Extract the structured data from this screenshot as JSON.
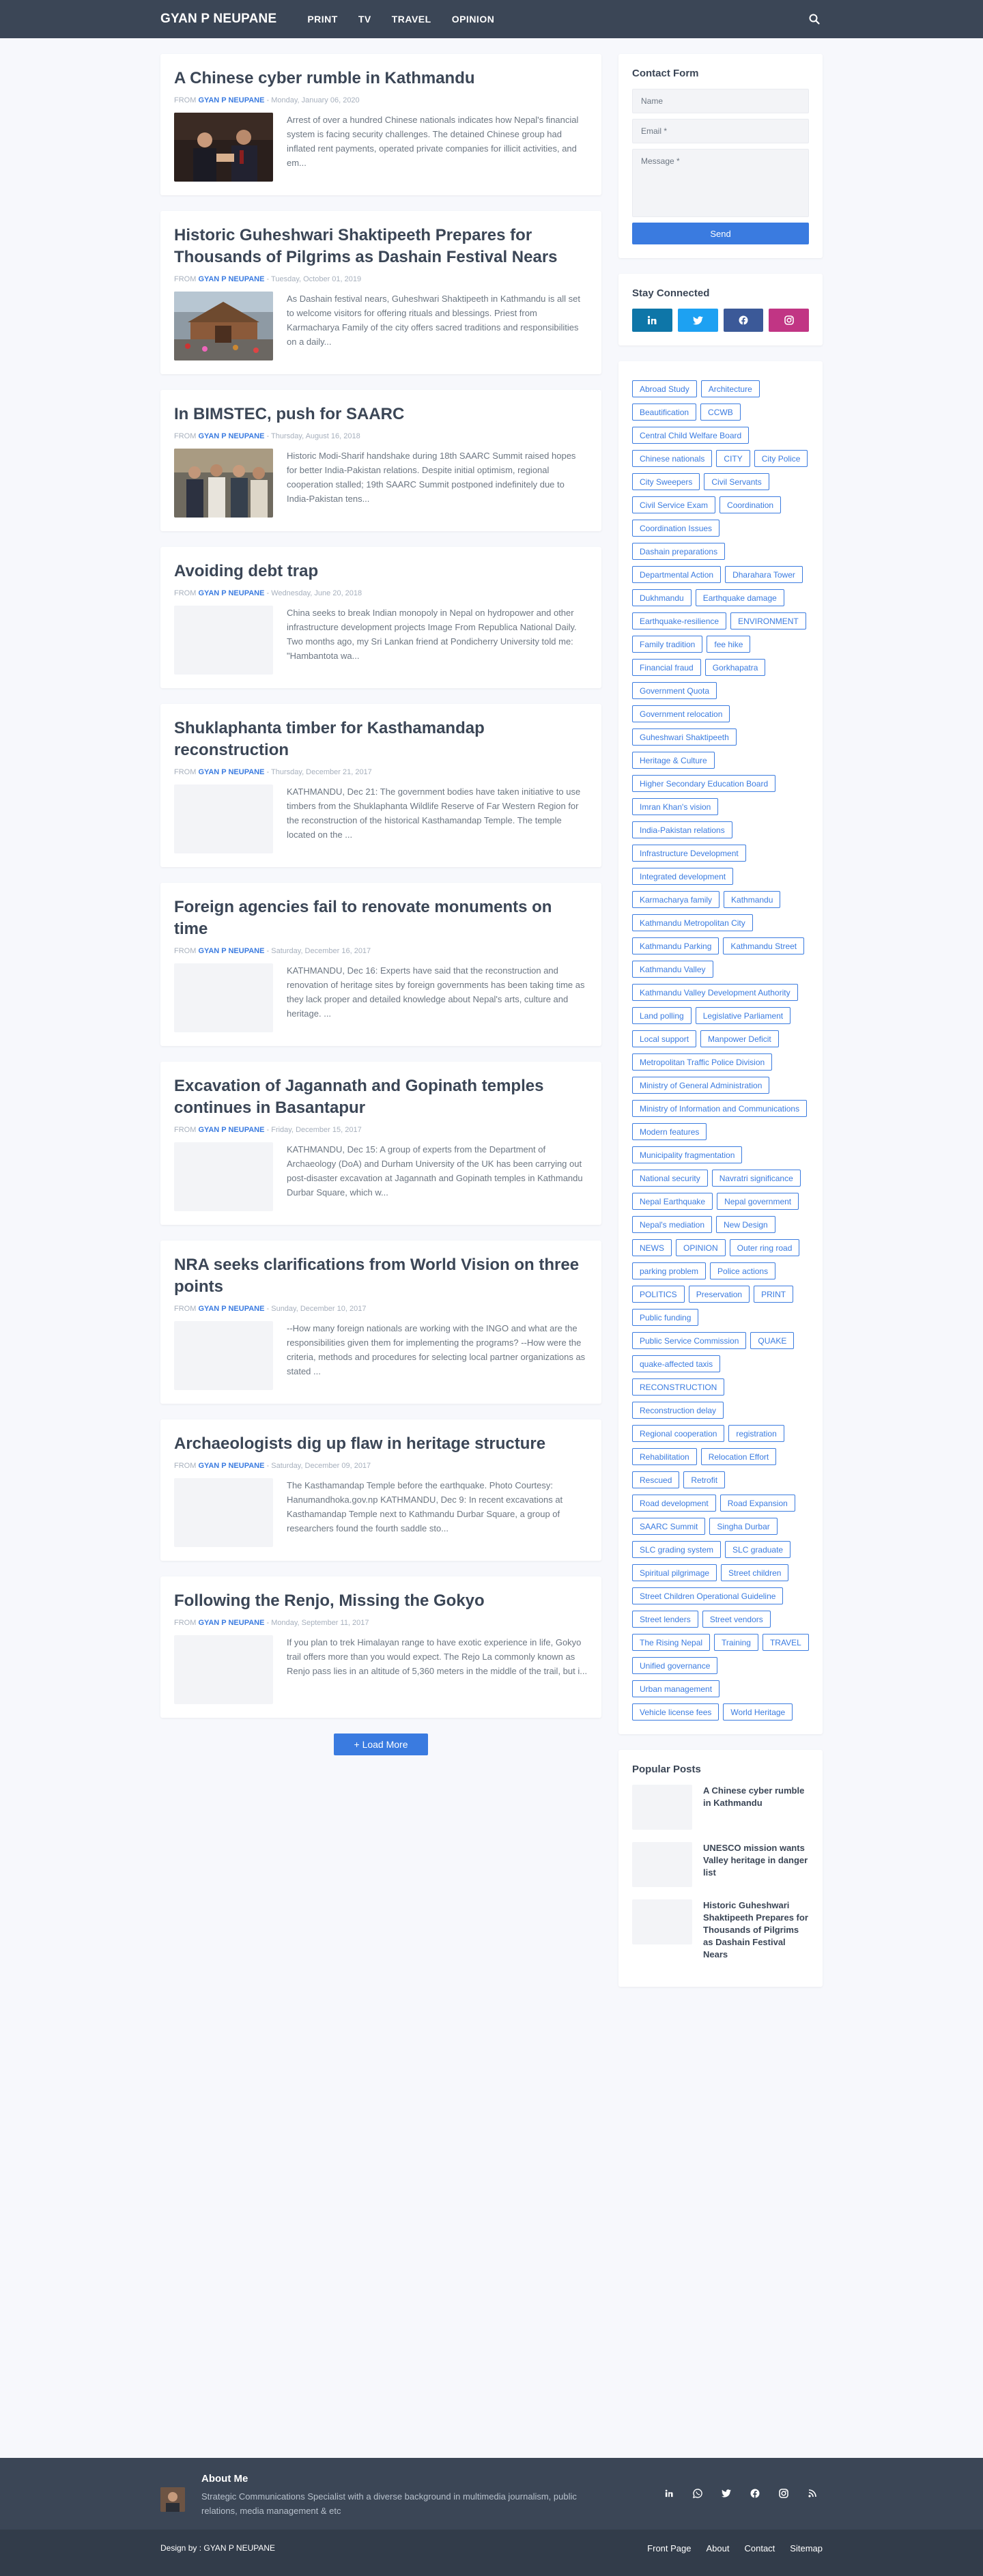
{
  "header": {
    "brand": "GYAN P NEUPANE",
    "menu": [
      "PRINT",
      "TV",
      "TRAVEL",
      "OPINION"
    ],
    "search_icon": "search-icon"
  },
  "posts": [
    {
      "title": "A Chinese cyber rumble in Kathmandu",
      "from": "FROM",
      "author": "GYAN P NEUPANE",
      "date": "Monday, January 06, 2020",
      "snippet": "Arrest of over a hundred Chinese nationals indicates how Nepal's financial system is facing security challenges. The detained Chinese group had inflated rent payments, operated private companies for illicit activities, and em...",
      "has_image": true
    },
    {
      "title": "Historic Guheshwari Shaktipeeth Prepares for Thousands of Pilgrims as Dashain Festival Nears",
      "from": "FROM",
      "author": "GYAN P NEUPANE",
      "date": "Tuesday, October 01, 2019",
      "snippet": "As Dashain festival nears, Guheshwari Shaktipeeth in Kathmandu is all set to welcome visitors for offering rituals and blessings. Priest from Karmacharya Family of the city offers sacred traditions and responsibilities on a daily...",
      "has_image": true
    },
    {
      "title": "In BIMSTEC, push for SAARC",
      "from": "FROM",
      "author": "GYAN P NEUPANE",
      "date": "Thursday, August 16, 2018",
      "snippet": "Historic Modi-Sharif handshake during 18th SAARC Summit raised hopes for better India-Pakistan relations. Despite initial optimism, regional cooperation stalled; 19th SAARC Summit postponed indefinitely due to India-Pakistan tens...",
      "has_image": true
    },
    {
      "title": "Avoiding debt trap",
      "from": "FROM",
      "author": "GYAN P NEUPANE",
      "date": "Wednesday, June 20, 2018",
      "snippet": "China seeks to break Indian monopoly in Nepal on hydropower and other infrastructure development projects Image From Republica National Daily. Two months ago, my Sri Lankan friend at Pondicherry University told me: \"Hambantota wa...",
      "has_image": false
    },
    {
      "title": "Shuklaphanta timber for Kasthamandap reconstruction",
      "from": "FROM",
      "author": "GYAN P NEUPANE",
      "date": "Thursday, December 21, 2017",
      "snippet": "KATHMANDU, Dec 21: The government bodies have taken initiative to use timbers from the Shuklaphanta Wildlife Reserve of Far Western Region for the reconstruction of the historical Kasthamandap Temple. The temple located on the ...",
      "has_image": false
    },
    {
      "title": "Foreign agencies fail to renovate monuments on time",
      "from": "FROM",
      "author": "GYAN P NEUPANE",
      "date": "Saturday, December 16, 2017",
      "snippet": "KATHMANDU, Dec 16: Experts have said that the reconstruction and renovation of heritage sites by foreign governments has been taking time as they lack proper and detailed knowledge about Nepal's arts, culture and heritage. ...",
      "has_image": false
    },
    {
      "title": "Excavation of Jagannath and Gopinath temples continues in Basantapur",
      "from": "FROM",
      "author": "GYAN P NEUPANE",
      "date": "Friday, December 15, 2017",
      "snippet": "KATHMANDU, Dec 15: A group of experts from the Department of Archaeology (DoA) and Durham University of the UK has been carrying out post-disaster excavation at Jagannath and Gopinath temples in Kathmandu Durbar Square, which w...",
      "has_image": false
    },
    {
      "title": "NRA seeks clarifications from World Vision on three points",
      "from": "FROM",
      "author": "GYAN P NEUPANE",
      "date": "Sunday, December 10, 2017",
      "snippet": "--How many foreign nationals are working with the INGO and what are the responsibilities given them for implementing the programs? --How were the criteria, methods and procedures for selecting local partner organizations as stated ...",
      "has_image": false
    },
    {
      "title": "Archaeologists dig up flaw in heritage structure",
      "from": "FROM",
      "author": "GYAN P NEUPANE",
      "date": "Saturday, December 09, 2017",
      "snippet": "The Kasthamandap Temple before the earthquake. Photo Courtesy: Hanumandhoka.gov.np KATHMANDU, Dec 9: In recent excavations at Kasthamandap Temple next to Kathmandu Durbar Square, a group of researchers found the fourth saddle sto...",
      "has_image": false
    },
    {
      "title": "Following the Renjo, Missing the Gokyo",
      "from": "FROM",
      "author": "GYAN P NEUPANE",
      "date": "Monday, September 11, 2017",
      "snippet": "If you plan to trek Himalayan range to have exotic experience in life, Gokyo trail offers more than you would expect. The Rejo La commonly known as Renjo pass lies in an altitude of 5,360 meters in the middle of the trail, but i...",
      "has_image": false
    }
  ],
  "load_more": "+ Load More",
  "contact": {
    "title": "Contact Form",
    "name_placeholder": "Name",
    "email_placeholder": "Email *",
    "message_placeholder": "Message *",
    "send": "Send"
  },
  "stay_connected": {
    "title": "Stay Connected",
    "buttons": [
      {
        "icon": "linkedin-icon",
        "color": "#0e76a8"
      },
      {
        "icon": "twitter-icon",
        "color": "#1da1f2"
      },
      {
        "icon": "facebook-icon",
        "color": "#3b5998"
      },
      {
        "icon": "instagram-icon",
        "color": "#c13584"
      }
    ]
  },
  "labels": [
    "Abroad Study",
    "Architecture",
    "Beautification",
    "CCWB",
    "Central Child Welfare Board",
    "Chinese nationals",
    "CITY",
    "City Police",
    "City Sweepers",
    "Civil Servants",
    "Civil Service Exam",
    "Coordination",
    "Coordination Issues",
    "Dashain preparations",
    "Departmental Action",
    "Dharahara Tower",
    "Dukhmandu",
    "Earthquake damage",
    "Earthquake-resilience",
    "ENVIRONMENT",
    "Family tradition",
    "fee hike",
    "Financial fraud",
    "Gorkhapatra",
    "Government Quota",
    "Government relocation",
    "Guheshwari Shaktipeeth",
    "Heritage & Culture",
    "Higher Secondary Education Board",
    "Imran Khan's vision",
    "India-Pakistan relations",
    "Infrastructure Development",
    "Integrated development",
    "Karmacharya family",
    "Kathmandu",
    "Kathmandu Metropolitan City",
    "Kathmandu Parking",
    "Kathmandu Street",
    "Kathmandu Valley",
    "Kathmandu Valley Development Authority",
    "Land polling",
    "Legislative Parliament",
    "Local support",
    "Manpower Deficit",
    "Metropolitan Traffic Police Division",
    "Ministry of General Administration",
    "Ministry of Information and Communications",
    "Modern features",
    "Municipality fragmentation",
    "National security",
    "Navratri significance",
    "Nepal Earthquake",
    "Nepal government",
    "Nepal's mediation",
    "New Design",
    "NEWS",
    "OPINION",
    "Outer ring road",
    "parking problem",
    "Police actions",
    "POLITICS",
    "Preservation",
    "PRINT",
    "Public funding",
    "Public Service Commission",
    "QUAKE",
    "quake-affected taxis",
    "RECONSTRUCTION",
    "Reconstruction delay",
    "Regional cooperation",
    "registration",
    "Rehabilitation",
    "Relocation Effort",
    "Rescued",
    "Retrofit",
    "Road development",
    "Road Expansion",
    "SAARC Summit",
    "Singha Durbar",
    "SLC grading system",
    "SLC graduate",
    "Spiritual pilgrimage",
    "Street children",
    "Street Children Operational Guideline",
    "Street lenders",
    "Street vendors",
    "The Rising Nepal",
    "Training",
    "TRAVEL",
    "Unified governance",
    "Urban management",
    "Vehicle license fees",
    "World Heritage"
  ],
  "popular": {
    "title": "Popular Posts",
    "items": [
      "A Chinese cyber rumble in Kathmandu",
      "UNESCO mission wants Valley heritage in danger list",
      "Historic Guheshwari Shaktipeeth Prepares for Thousands of Pilgrims as Dashain Festival Nears"
    ]
  },
  "footer": {
    "about_title": "About Me",
    "about_text": "Strategic Communications Specialist with a diverse background in multimedia journalism, public relations, media management & etc",
    "social": [
      "linkedin-icon",
      "whatsapp-icon",
      "twitter-icon",
      "facebook-icon",
      "instagram-icon",
      "rss-icon"
    ],
    "credit": "Design by : GYAN P NEUPANE",
    "links": [
      "Front Page",
      "About",
      "Contact",
      "Sitemap"
    ]
  }
}
